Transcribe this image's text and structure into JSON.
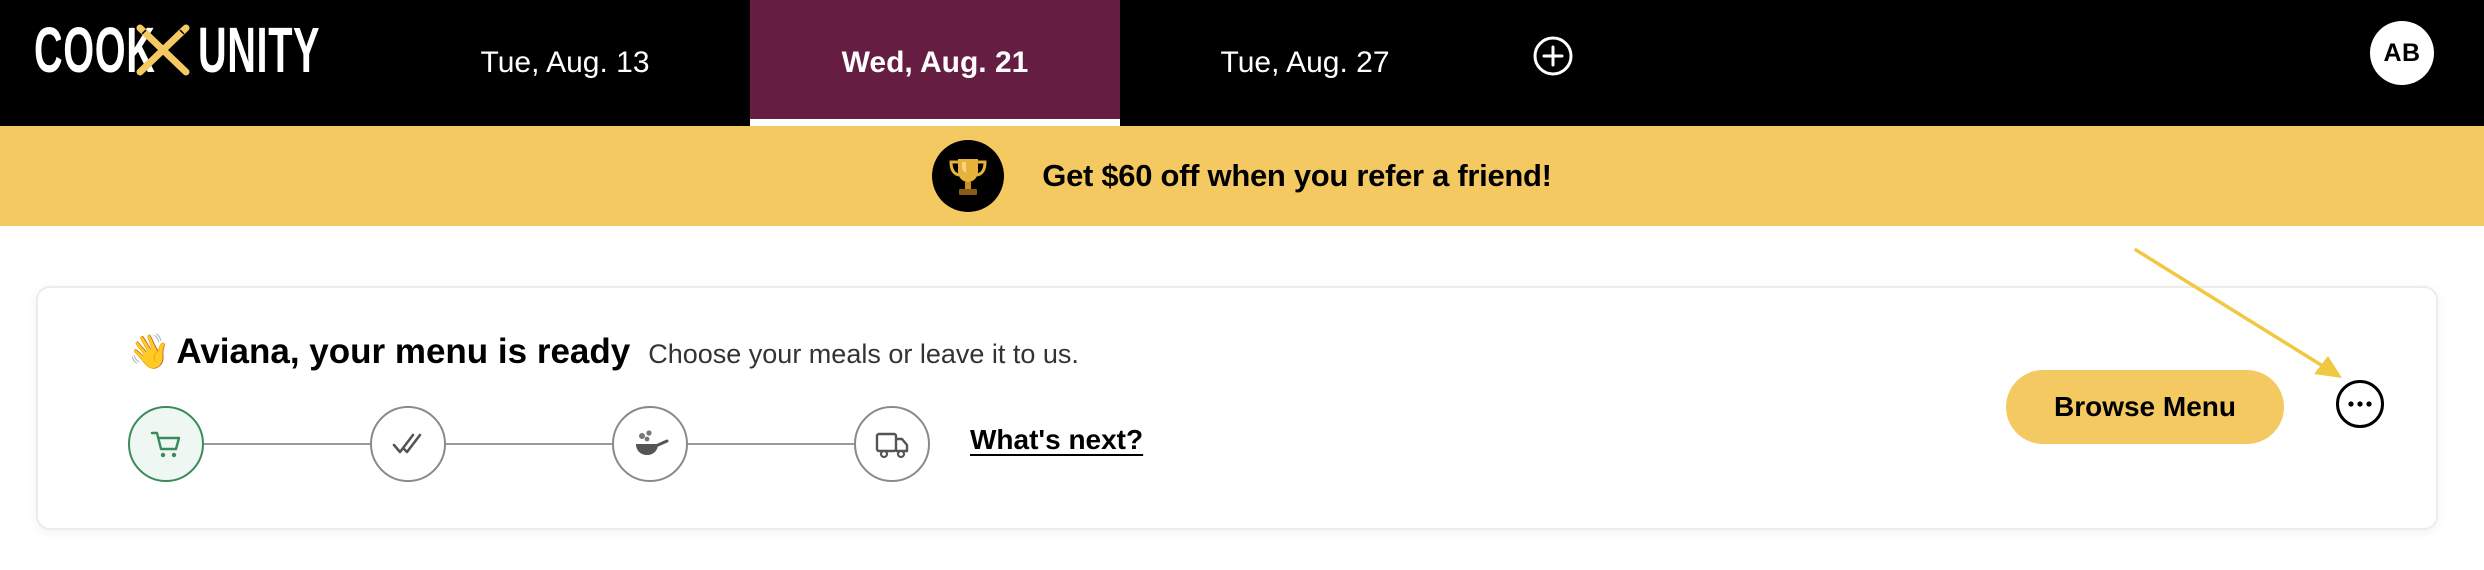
{
  "header": {
    "logo_left": "COOK",
    "logo_right": "UNITY",
    "date_tabs": [
      {
        "label": "Tue, Aug. 13",
        "active": false
      },
      {
        "label": "Wed, Aug. 21",
        "active": true
      },
      {
        "label": "Tue, Aug. 27",
        "active": false
      }
    ],
    "add_icon": "plus-circle-icon",
    "avatar_initials": "AB"
  },
  "promo": {
    "icon": "trophy-icon",
    "text": "Get $60 off when you refer a friend!"
  },
  "card": {
    "emoji": "👋",
    "title": "Aviana, your menu is ready",
    "subtitle": "Choose your meals or leave it to us.",
    "steps": [
      {
        "icon": "cart-icon",
        "active": true
      },
      {
        "icon": "double-check-icon",
        "active": false
      },
      {
        "icon": "cooking-pan-icon",
        "active": false
      },
      {
        "icon": "delivery-truck-icon",
        "active": false
      }
    ],
    "whats_next": "What's next?",
    "browse_label": "Browse Menu",
    "more_icon": "more-options-icon"
  },
  "colors": {
    "nav_bg": "#000000",
    "active_tab": "#651e42",
    "promo_yellow": "#f5c962",
    "step_active_green": "#3a8a5a",
    "annotation_arrow": "#f0c842"
  }
}
